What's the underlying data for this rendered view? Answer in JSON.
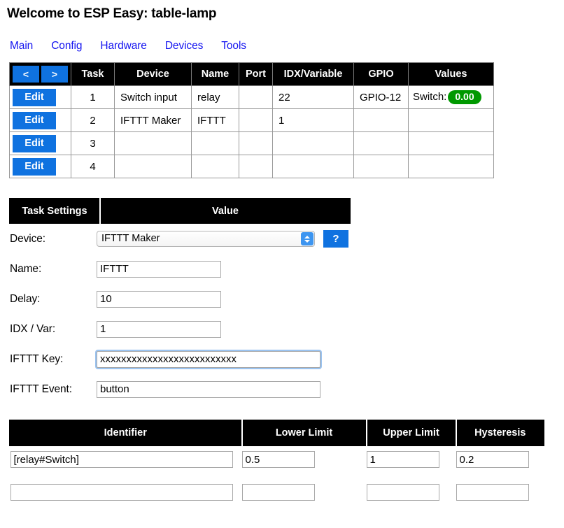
{
  "header": {
    "title": "Welcome to ESP Easy: table-lamp",
    "nav": [
      {
        "label": "Main"
      },
      {
        "label": "Config"
      },
      {
        "label": "Hardware"
      },
      {
        "label": "Devices"
      },
      {
        "label": "Tools"
      }
    ]
  },
  "devices_table": {
    "pager": {
      "prev_label": "<",
      "next_label": ">"
    },
    "columns": [
      "Task",
      "Device",
      "Name",
      "Port",
      "IDX/Variable",
      "GPIO",
      "Values"
    ],
    "edit_label": "Edit",
    "rows": [
      {
        "task": "1",
        "device": "Switch input",
        "name": "relay",
        "port": "",
        "idx": "22",
        "gpio": "GPIO-12",
        "value_label": "Switch:",
        "value_badge": "0.00",
        "badge_color": "#009900"
      },
      {
        "task": "2",
        "device": "IFTTT Maker",
        "name": "IFTTT",
        "port": "",
        "idx": "1",
        "gpio": "",
        "value_label": "",
        "value_badge": "",
        "badge_color": ""
      },
      {
        "task": "3",
        "device": "",
        "name": "",
        "port": "",
        "idx": "",
        "gpio": "",
        "value_label": "",
        "value_badge": "",
        "badge_color": ""
      },
      {
        "task": "4",
        "device": "",
        "name": "",
        "port": "",
        "idx": "",
        "gpio": "",
        "value_label": "",
        "value_badge": "",
        "badge_color": ""
      }
    ]
  },
  "task_settings": {
    "header_left": "Task Settings",
    "header_right": "Value",
    "device": {
      "label": "Device:",
      "selected": "IFTTT Maker",
      "help_label": "?"
    },
    "name": {
      "label": "Name:",
      "value": "IFTTT"
    },
    "delay": {
      "label": "Delay:",
      "value": "10"
    },
    "idx": {
      "label": "IDX / Var:",
      "value": "1"
    },
    "key": {
      "label": "IFTTT Key:",
      "value": "xxxxxxxxxxxxxxxxxxxxxxxxxx"
    },
    "event": {
      "label": "IFTTT Event:",
      "value": "button"
    }
  },
  "limits_table": {
    "columns": [
      "Identifier",
      "Lower Limit",
      "Upper Limit",
      "Hysteresis"
    ],
    "rows": [
      {
        "identifier": "[relay#Switch]",
        "lower": "0.5",
        "upper": "1",
        "hysteresis": "0.2"
      },
      {
        "identifier": "",
        "lower": "",
        "upper": "",
        "hysteresis": ""
      }
    ]
  },
  "theme": {
    "button_blue": "#0f72e0",
    "link_blue": "#1414f0",
    "header_black": "#000000",
    "badge_green": "#009900"
  }
}
